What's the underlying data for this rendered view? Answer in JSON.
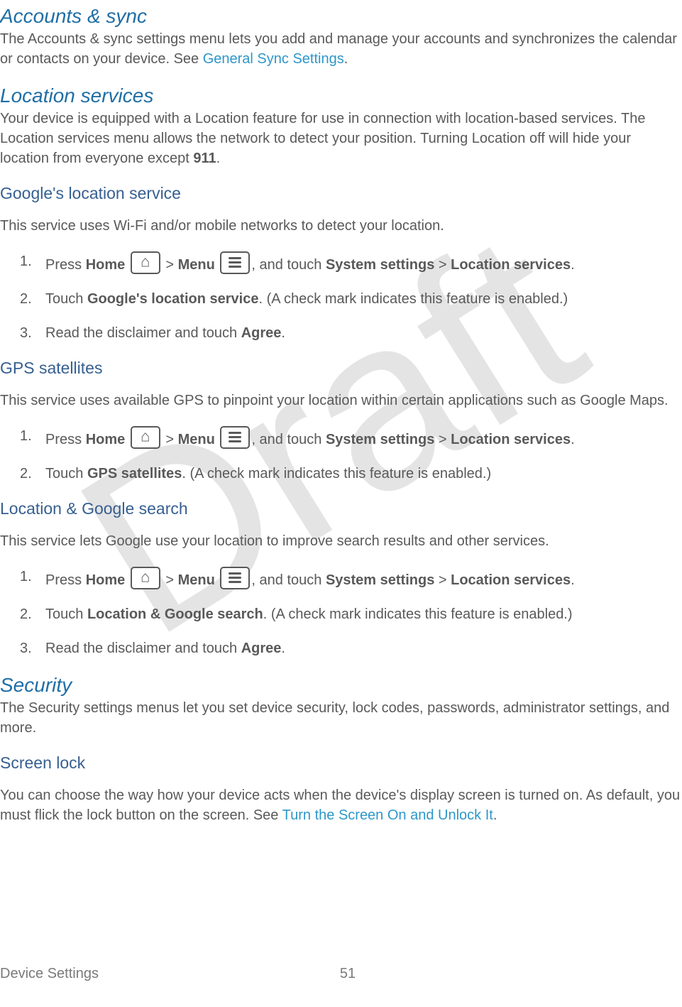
{
  "watermark": "Draft",
  "sections": {
    "accounts_sync": {
      "title": "Accounts & sync",
      "intro_p1": "The Accounts & sync settings menu lets you add and manage your accounts and synchronizes the calendar or contacts on your device. See ",
      "intro_link": "General Sync Settings",
      "intro_p2": "."
    },
    "location_services": {
      "title": "Location services",
      "intro": "Your device is equipped with a Location feature for use in connection with location-based services. The Location services menu allows the network to detect your position. Turning Location off will hide your location from everyone except ",
      "bold911": "911",
      "intro_end": "."
    },
    "google_loc": {
      "title": "Google's location service",
      "intro": "This service uses Wi-Fi and/or mobile networks to detect your location.",
      "s1_a": "Press ",
      "s1_home": "Home",
      "s1_gt": " > ",
      "s1_menu": "Menu",
      "s1_b": ", and touch ",
      "s1_sys": "System settings",
      "s1_gt2": " > ",
      "s1_loc": "Location services",
      "s1_end": ".",
      "s2_a": "Touch ",
      "s2_b": "Google's location service",
      "s2_c": ". (A check mark indicates this feature is enabled.)",
      "s3_a": "Read the disclaimer and touch ",
      "s3_b": "Agree",
      "s3_c": "."
    },
    "gps": {
      "title": "GPS satellites",
      "intro": "This service uses available GPS to pinpoint your location within certain applications such as Google Maps.",
      "s1_a": "Press ",
      "s1_home": "Home",
      "s1_gt": " > ",
      "s1_menu": "Menu",
      "s1_b": ", and touch ",
      "s1_sys": "System settings",
      "s1_gt2": " > ",
      "s1_loc": "Location services",
      "s1_end": ".",
      "s2_a": "Touch ",
      "s2_b": "GPS satellites",
      "s2_c": ". (A check mark indicates this feature is enabled.)"
    },
    "loc_search": {
      "title": "Location & Google search",
      "intro": "This service lets Google use your location to improve search results and other services.",
      "s1_a": "Press ",
      "s1_home": "Home",
      "s1_gt": " > ",
      "s1_menu": "Menu",
      "s1_b": ", and touch ",
      "s1_sys": "System settings",
      "s1_gt2": " > ",
      "s1_loc": "Location services",
      "s1_end": ".",
      "s2_a": "Touch ",
      "s2_b": "Location & Google search",
      "s2_c": ". (A check mark indicates this feature is enabled.)",
      "s3_a": "Read the disclaimer and touch ",
      "s3_b": "Agree",
      "s3_c": "."
    },
    "security": {
      "title": "Security",
      "intro": "The Security settings menus let you set device security, lock codes, passwords, administrator settings, and more."
    },
    "screen_lock": {
      "title": "Screen lock",
      "intro_a": "You can choose the way how your device acts when the device's display screen is turned on. As default, you must flick the lock button on the screen. See ",
      "intro_link": "Turn the Screen On and Unlock It",
      "intro_b": "."
    }
  },
  "footer": {
    "left": "Device Settings",
    "page": "51"
  }
}
